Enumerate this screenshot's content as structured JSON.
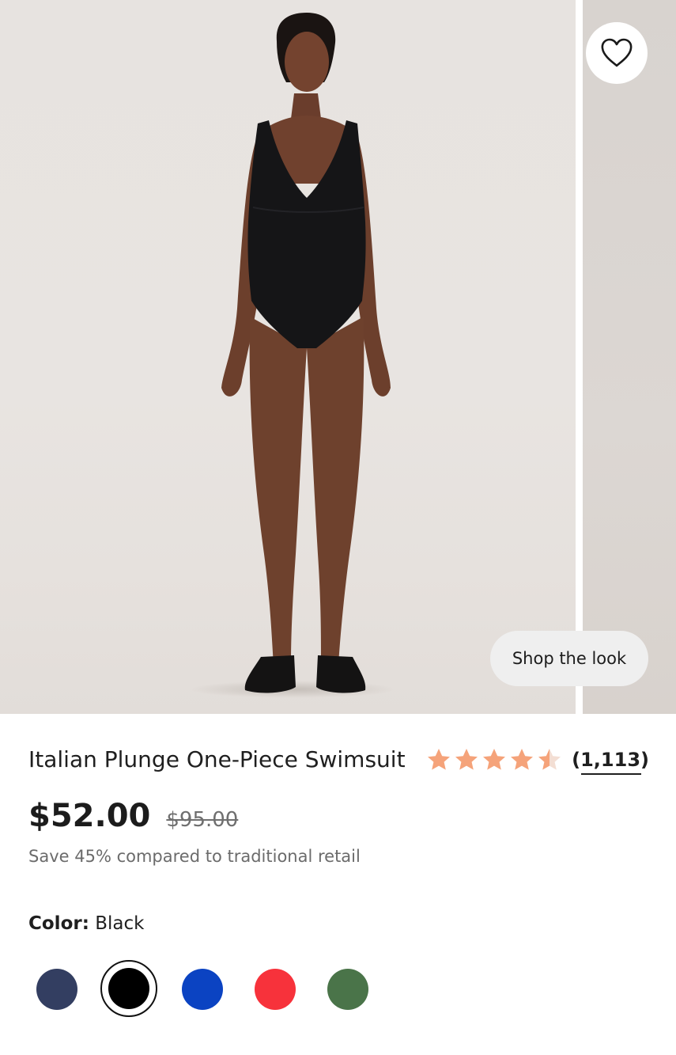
{
  "gallery": {
    "shop_the_look_label": "Shop the look",
    "favorite_icon": "heart-outline-icon"
  },
  "product": {
    "title": "Italian Plunge One-Piece Swimsuit",
    "rating": 4.5,
    "rating_max": 5,
    "review_count": "(1,113)",
    "price": "$52.00",
    "compare_price": "$95.00",
    "savings_note": "Save 45% compared to traditional retail"
  },
  "color": {
    "label": "Color:",
    "selected": "Black",
    "swatches": [
      {
        "name": "Navy",
        "hex": "#333e61"
      },
      {
        "name": "Black",
        "hex": "#000000",
        "selected": true
      },
      {
        "name": "Blue",
        "hex": "#0b43c2"
      },
      {
        "name": "Red",
        "hex": "#f7323b"
      },
      {
        "name": "Green",
        "hex": "#4a7449"
      }
    ]
  },
  "colors": {
    "star_fill": "#f5a37a",
    "star_empty": "#f3ded3",
    "text_primary": "#1f1f1f",
    "text_muted": "#6b6b6b"
  }
}
